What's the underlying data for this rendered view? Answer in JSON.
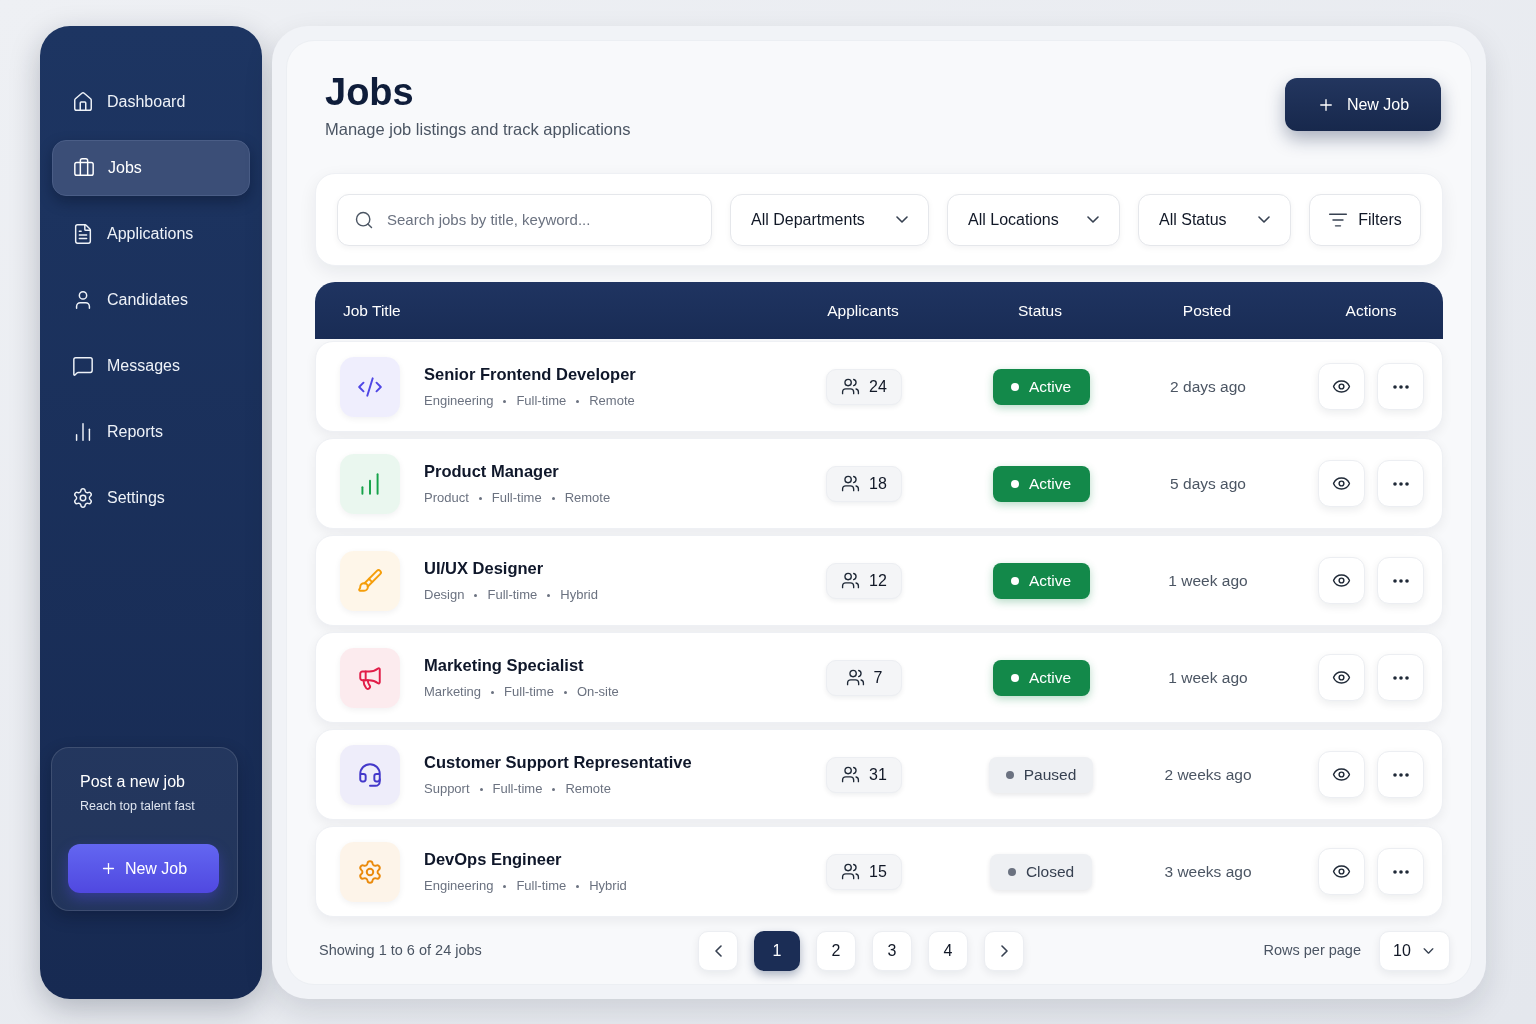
{
  "sidebar": {
    "items": [
      {
        "label": "Dashboard",
        "selected": false
      },
      {
        "label": "Jobs",
        "selected": true
      },
      {
        "label": "Applications",
        "selected": false
      },
      {
        "label": "Candidates",
        "selected": false
      },
      {
        "label": "Messages",
        "selected": false
      },
      {
        "label": "Reports",
        "selected": false
      },
      {
        "label": "Settings",
        "selected": false
      }
    ],
    "promo": {
      "title": "Post a new job",
      "subtitle": "Reach top talent fast",
      "button": "New Job"
    }
  },
  "header": {
    "title": "Jobs",
    "subtitle": "Manage job listings and track applications",
    "button": "New Job"
  },
  "filters": {
    "search": {
      "placeholder": "Search jobs by title, keyword..."
    },
    "dropdowns": [
      "All Departments",
      "All Locations",
      "All Status"
    ],
    "button": "Filters"
  },
  "table": {
    "columns": [
      "Job Title",
      "Applicants",
      "Status",
      "Posted",
      "Actions"
    ],
    "rows": [
      {
        "title": "Senior Frontend Developer",
        "tags": [
          "Engineering",
          "Full-time",
          "Remote"
        ],
        "color": "#4f46e5",
        "applicants": "24",
        "status": {
          "label": "Active",
          "kind": "active"
        },
        "posted": "2 days ago"
      },
      {
        "title": "Product Manager",
        "tags": [
          "Product",
          "Full-time",
          "Remote"
        ],
        "color": "#16a34a",
        "applicants": "18",
        "status": {
          "label": "Active",
          "kind": "active"
        },
        "posted": "5 days ago"
      },
      {
        "title": "UI/UX Designer",
        "tags": [
          "Design",
          "Full-time",
          "Hybrid"
        ],
        "color": "#f59e0b",
        "applicants": "12",
        "status": {
          "label": "Active",
          "kind": "active"
        },
        "posted": "1 week ago"
      },
      {
        "title": "Marketing Specialist",
        "tags": [
          "Marketing",
          "Full-time",
          "On-site"
        ],
        "color": "#e11d48",
        "applicants": "7",
        "status": {
          "label": "Active",
          "kind": "active"
        },
        "posted": "1 week ago"
      },
      {
        "title": "Customer Support Representative",
        "tags": [
          "Support",
          "Full-time",
          "Remote"
        ],
        "color": "#4338ca",
        "applicants": "31",
        "status": {
          "label": "Paused",
          "kind": "paused"
        },
        "posted": "2 weeks ago"
      },
      {
        "title": "DevOps Engineer",
        "tags": [
          "Engineering",
          "Full-time",
          "Hybrid"
        ],
        "color": "#ea8a0c",
        "applicants": "15",
        "status": {
          "label": "Closed",
          "kind": "closed"
        },
        "posted": "3 weeks ago"
      }
    ]
  },
  "pagination": {
    "summary": "Showing 1 to 6 of 24 jobs",
    "pages": [
      {
        "label": "1",
        "selected": true
      },
      {
        "label": "2",
        "selected": false
      },
      {
        "label": "3",
        "selected": false
      },
      {
        "label": "4",
        "selected": false
      }
    ],
    "rows_per_page": {
      "label": "Rows per page",
      "value": "10"
    }
  }
}
